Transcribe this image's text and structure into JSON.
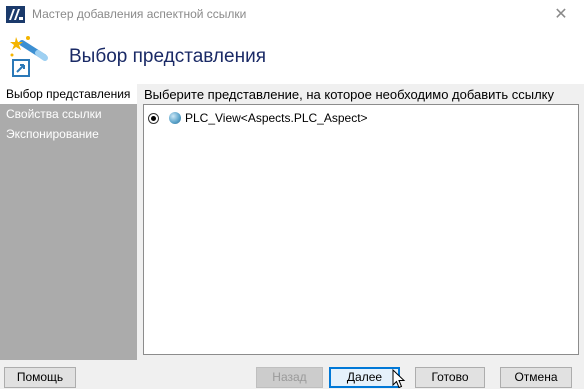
{
  "window": {
    "title": "Мастер добавления аспектной ссылки",
    "close_glyph": "✕",
    "app_icon": "app-logo-icon"
  },
  "header": {
    "title": "Выбор представления",
    "icon": "magic-wand-icon"
  },
  "sidebar": {
    "items": [
      {
        "label": "Выбор представления",
        "active": true
      },
      {
        "label": "Свойства ссылки",
        "active": false
      },
      {
        "label": "Экспонирование",
        "active": false
      }
    ]
  },
  "main": {
    "instruction": "Выберите представление, на которое необходимо добавить ссылку",
    "views": [
      {
        "label": "PLC_View<Aspects.PLC_Aspect>",
        "selected": true,
        "icon": "view-sphere-icon"
      }
    ]
  },
  "buttons": {
    "help": "Помощь",
    "back": "Назад",
    "next": "Далее",
    "finish": "Готово",
    "cancel": "Отмена"
  },
  "colors": {
    "sidebar_bg": "#ababab",
    "title_color": "#1a2a66",
    "default_button_border": "#0078d7"
  }
}
